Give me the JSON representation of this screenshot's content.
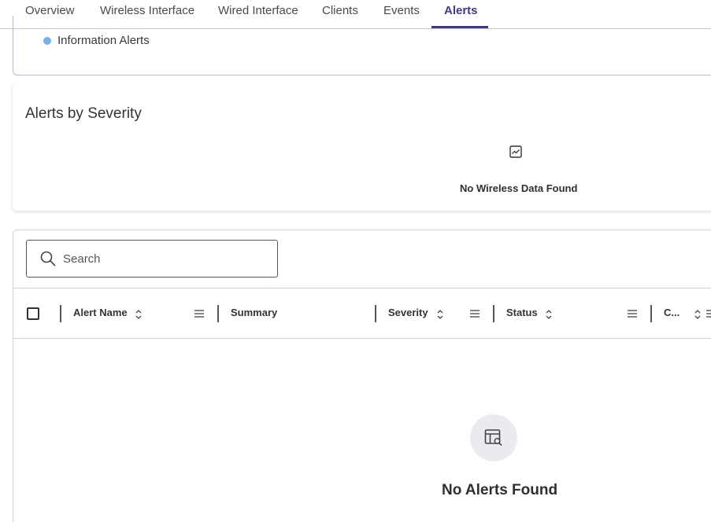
{
  "tabs": [
    {
      "label": "Overview"
    },
    {
      "label": "Wireless Interface"
    },
    {
      "label": "Wired Interface"
    },
    {
      "label": "Clients"
    },
    {
      "label": "Events"
    },
    {
      "label": "Alerts"
    }
  ],
  "active_tab": "Alerts",
  "top_card": {
    "legend_label": "Information Alerts",
    "legend_color": "#7aaee8"
  },
  "severity": {
    "title": "Alerts by Severity",
    "empty_icon": "chart-line-icon",
    "empty_message": "No Wireless Data Found"
  },
  "search": {
    "placeholder": "Search",
    "value": ""
  },
  "table": {
    "columns": [
      {
        "label": "Alert Name"
      },
      {
        "label": "Summary"
      },
      {
        "label": "Severity"
      },
      {
        "label": "Status"
      },
      {
        "label": "C..."
      }
    ],
    "empty_icon": "table-search-icon",
    "empty_message": "No Alerts Found"
  },
  "colors": {
    "accent": "#3f3a82",
    "info": "#7aaee8"
  }
}
